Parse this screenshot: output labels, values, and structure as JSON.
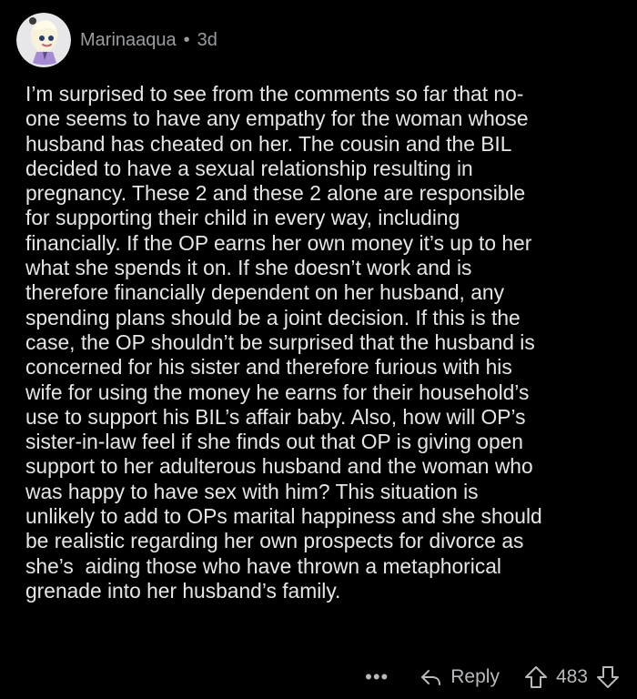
{
  "comment": {
    "author": "Marinaaqua",
    "separator": "•",
    "age": "3d",
    "body": "I’m surprised to see from the comments so far that no-\none seems to have any empathy for the woman whose\nhusband has cheated on her. The cousin and the BIL\ndecided to have a sexual relationship resulting in\npregnancy. These 2 and these 2 alone are responsible\nfor supporting their child in every way, including\nfinancially. If the OP earns her own money it’s up to her\nwhat she spends it on. If she doesn’t work and is\ntherefore financially dependent on her husband, any\nspending plans should be a joint decision. If this is the\ncase, the OP shouldn’t be surprised that the husband is\nconcerned for his sister and therefore furious with his\nwife for using the money he earns for their household’s\nuse to support his BIL’s affair baby. Also, how will OP’s\nsister-in-law feel if she finds out that OP is giving open\nsupport to her adulterous husband and the woman who\nwas happy to have sex with him? This situation is\nunlikely to add to OPs marital happiness and she should\nbe realistic regarding her own prospects for divorce as\nshe’s  aiding those who have thrown a metaphorical\ngrenade into her husband’s family."
  },
  "actions": {
    "more": "•••",
    "reply_label": "Reply",
    "vote_count": "483"
  },
  "icons": {
    "more": "more-icon",
    "reply": "reply-icon",
    "upvote": "upvote-icon",
    "downvote": "downvote-icon"
  },
  "colors": {
    "background": "#000000",
    "text": "#e4e6e8",
    "meta": "#9a9da0",
    "avatar_bg": "#e7e7ea"
  }
}
